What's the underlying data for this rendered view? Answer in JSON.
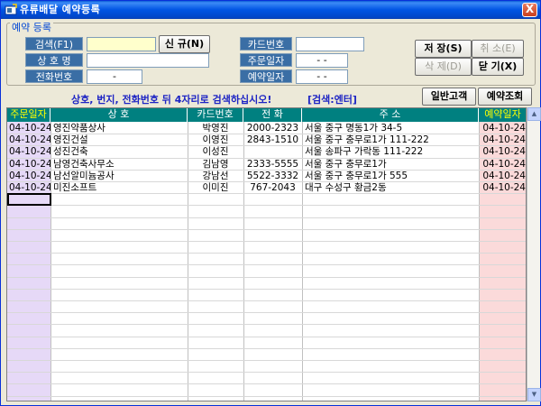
{
  "window": {
    "title": "유류배달 예약등록",
    "close_label": "X"
  },
  "group": {
    "title": "예약 등록"
  },
  "form": {
    "search_label": "검색(F1)",
    "search_value": "",
    "name_label": "상 호 명",
    "name_value": "",
    "phone_label": "전화번호",
    "phone_value": "-",
    "card_label": "카드번호",
    "card_value": "",
    "order_date_label": "주문일자",
    "order_date_value": "- -",
    "reserve_date_label": "예약일자",
    "reserve_date_value": "- -"
  },
  "buttons": {
    "new": "신 규(N)",
    "save": "저 장(S)",
    "cancel": "취 소(E)",
    "delete": "삭 제(D)",
    "close": "닫 기(X)",
    "general_customer": "일반고객",
    "reservation_lookup": "예약조회"
  },
  "hint": {
    "main": "상호, 번지, 전화번호 뒤 4자리로 검색하십시오!",
    "secondary": "[검색:엔터]"
  },
  "table": {
    "headers": [
      "주문일자",
      "상 호",
      "카드번호",
      "전 화",
      "주 소",
      "예약일자"
    ],
    "rows": [
      [
        "04-10-24",
        "영진약품상사",
        "박영진",
        "2000-2323",
        "서울 중구 명동1가 34-5",
        "04-10-24"
      ],
      [
        "04-10-24",
        "영진건설",
        "이영진",
        "2843-1510",
        "서울 중구 충무로1가 111-222",
        "04-10-24"
      ],
      [
        "04-10-24",
        "성진건축",
        "이성진",
        "",
        "서울 송파구 가락동 111-222",
        "04-10-24"
      ],
      [
        "04-10-24",
        "남영건축사무소",
        "김남영",
        "2333-5555",
        "서울 중구 충무로1가",
        "04-10-24"
      ],
      [
        "04-10-24",
        "남선알미늄공사",
        "강남선",
        "5522-3332",
        "서울 중구 충무로1가 555",
        "04-10-24"
      ],
      [
        "04-10-24",
        "미진소프트",
        "이미진",
        "767-2043",
        "대구 수성구 황금2동",
        "04-10-24"
      ]
    ]
  },
  "colors": {
    "header_bg": "#008080",
    "order_col": "#e6d9f7",
    "reserve_col": "#fbdada",
    "label_bg": "#3a6ea5"
  }
}
